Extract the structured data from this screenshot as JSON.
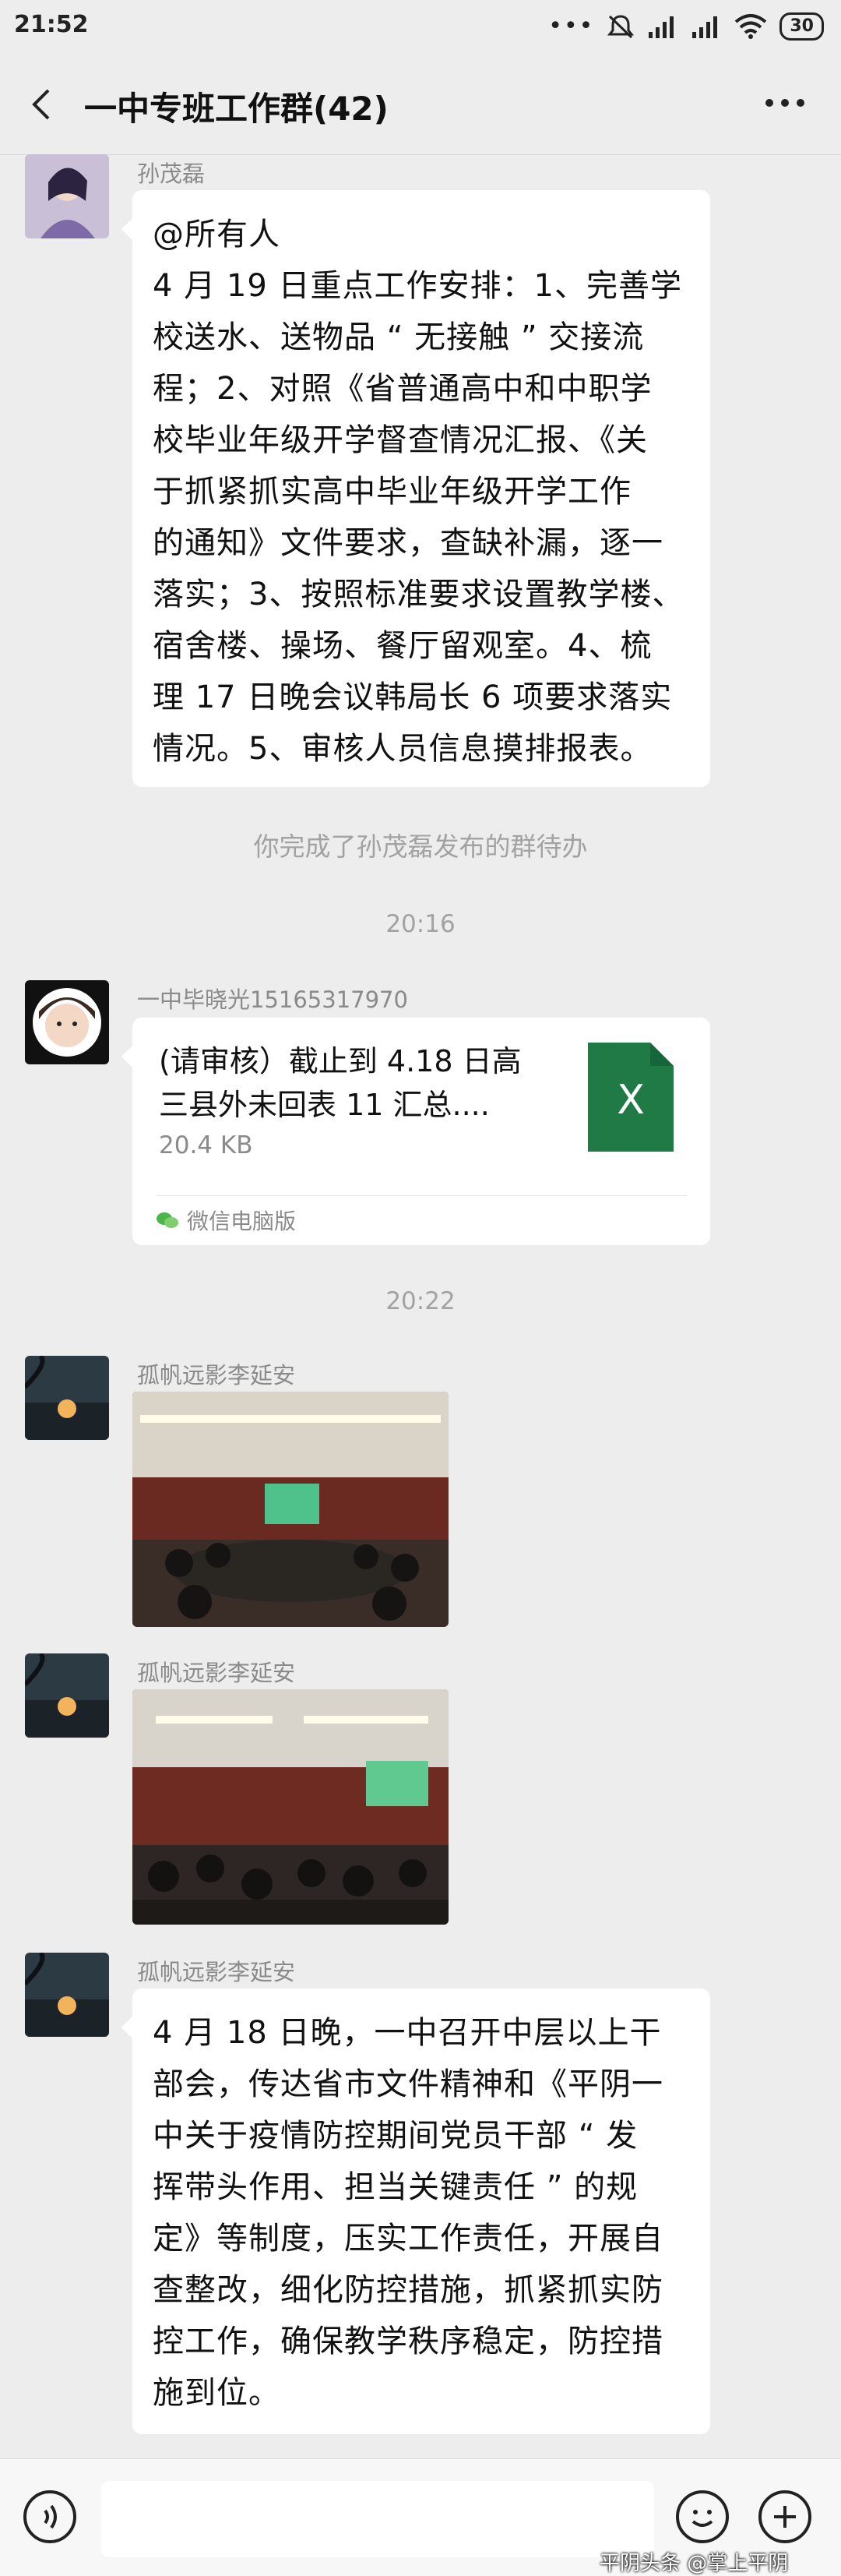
{
  "status_bar": {
    "time": "21:52",
    "signal_dots": "•••",
    "battery": "30"
  },
  "header": {
    "title": "一中专班工作群(42)"
  },
  "messages": {
    "m1": {
      "sender": "孙茂磊",
      "lines": [
        "@所有人",
        "4 月 19 日重点工作安排：1、完善学",
        "校送水、送物品 “ 无接触 ” 交接流",
        "程；2、对照《省普通高中和中职学",
        "校毕业年级开学督查情况汇报、《关",
        "于抓紧抓实高中毕业年级开学工作",
        "的通知》文件要求，查缺补漏，逐一",
        "落实；3、按照标准要求设置教学楼、",
        "宿舍楼、操场、餐厅留观室。4、梳",
        "理 17 日晚会议韩局长 6 项要求落实",
        "情况。5、审核人员信息摸排报表。"
      ]
    },
    "system_notice": "你完成了孙茂磊发布的群待办",
    "time1": "20:16",
    "m2": {
      "sender": "一中毕晓光15165317970",
      "file_name_line1": "(请审核）截止到 4.18 日高",
      "file_name_line2": "三县外未回表 11 汇总....",
      "file_size": "20.4 KB",
      "file_icon_letter": "X",
      "source": "微信电脑版"
    },
    "time2": "20:22",
    "m3": {
      "sender": "孤帆远影李延安"
    },
    "m4": {
      "sender": "孤帆远影李延安"
    },
    "m5": {
      "sender": "孤帆远影李延安",
      "lines": [
        "4 月 18 日晚，一中召开中层以上干",
        "部会，传达省市文件精神和《平阴一",
        "中关于疫情防控期间党员干部 “ 发",
        "挥带头作用、担当关键责任 ” 的规",
        "定》等制度，压实工作责任，开展自",
        "查整改，细化防控措施，抓紧抓实防",
        "控工作，确保教学秩序稳定，防控措",
        "施到位。"
      ]
    }
  },
  "watermark": "平阴头条 @掌上平阴",
  "colors": {
    "bg": "#ededed",
    "excel": "#1f7a45",
    "bubble": "#ffffff"
  }
}
